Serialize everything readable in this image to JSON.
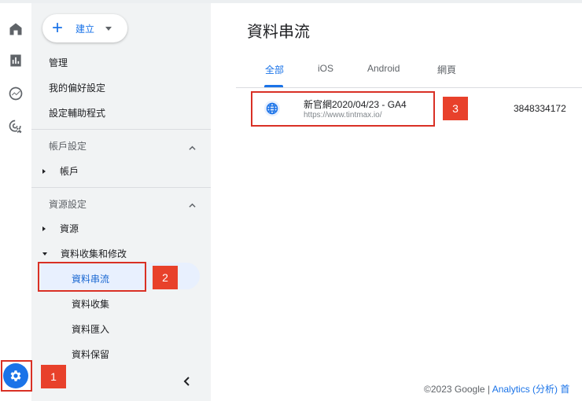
{
  "rail": {
    "icons": [
      "home-icon",
      "reports-icon",
      "explore-icon",
      "advertising-icon"
    ]
  },
  "sidebar": {
    "create_label": "建立",
    "links": [
      "管理",
      "我的偏好設定",
      "設定輔助程式"
    ],
    "account_section": {
      "title": "帳戶設定",
      "items": [
        "帳戶"
      ]
    },
    "property_section": {
      "title": "資源設定",
      "items": [
        "資源",
        "資料收集和修改"
      ],
      "subitems": [
        "資料串流",
        "資料收集",
        "資料匯入",
        "資料保留"
      ]
    }
  },
  "main": {
    "title": "資料串流",
    "tabs": [
      "全部",
      "iOS",
      "Android",
      "網頁"
    ],
    "active_tab": "全部",
    "streams": [
      {
        "name": "新官網2020/04/23 - GA4",
        "url": "https://www.tintmax.io/",
        "id": "3848334172",
        "icon": "globe-icon"
      }
    ]
  },
  "footer": {
    "copyright": "©2023 Google | ",
    "link": "Analytics (分析) 首"
  },
  "annotations": [
    "1",
    "2",
    "3"
  ],
  "colors": {
    "accent": "#1a73e8",
    "annotation": "#e8412b",
    "sidebar_bg": "#f1f3f4",
    "active_bg": "#e8f0fe"
  }
}
